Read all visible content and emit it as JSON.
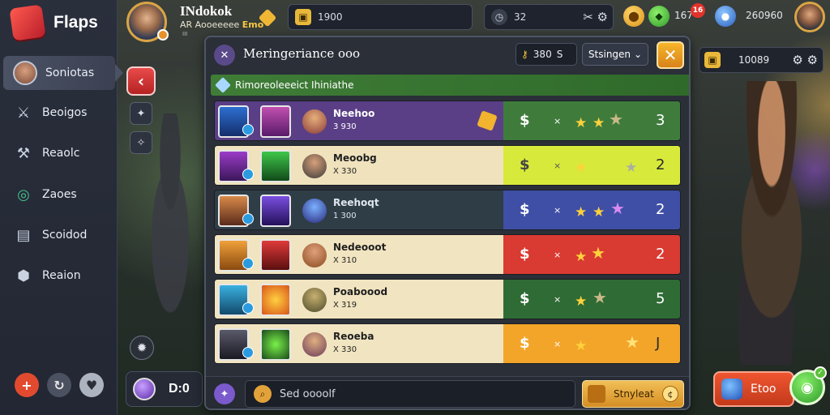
{
  "sidebar": {
    "logo_text": "Flaps",
    "items": [
      {
        "label": "Soniotas",
        "icon": "avatar",
        "active": true
      },
      {
        "label": "Beoigos",
        "icon": "sword-icon"
      },
      {
        "label": "Reaolc",
        "icon": "hammer-icon"
      },
      {
        "label": "Zaoes",
        "icon": "orb-icon"
      },
      {
        "label": "Scoidod",
        "icon": "scroll-icon"
      },
      {
        "label": "Reaion",
        "icon": "cube-icon"
      }
    ],
    "bottom_buttons": [
      {
        "name": "add",
        "glyph": "+"
      },
      {
        "name": "refresh",
        "glyph": "↻"
      },
      {
        "name": "heart",
        "glyph": "♥"
      }
    ]
  },
  "player": {
    "name": "INdokok",
    "sub_prefix": "AR Aooeeeee",
    "sub_gold": "Emo",
    "tag": "III"
  },
  "topbar": {
    "field_one": "1900",
    "field_two": "32",
    "coin_gold_label": "",
    "coin_green_label": "167",
    "notif_count": "16",
    "right_value": "260960"
  },
  "right_toolbar": {
    "value": "10089"
  },
  "panel": {
    "title": "Meringeriance ooo",
    "field_value": "380",
    "field_suffix": "S",
    "select_label": "Stsingen",
    "close_glyph": "✕",
    "subheader": "Rimoreoleeeict Ihiniathe",
    "rows": [
      {
        "name": "Neehoo",
        "sub": "3 930",
        "left_bg": "#5a3f86",
        "left_color": "#ffffff",
        "right_bg": "#3f7c3c",
        "stars": 3,
        "number": "3",
        "num_color": "#ffffff",
        "gem": true
      },
      {
        "name": "Meoobg",
        "sub": "X 330",
        "left_bg": "#efe2bd",
        "left_color": "#1f1f1f",
        "right_bg": "#d7ea3b",
        "stars": 1,
        "number": "2",
        "num_color": "#2a2a2a",
        "gem": false
      },
      {
        "name": "Reehoqt",
        "sub": "1 300",
        "left_bg": "#2f3d47",
        "left_color": "#dfe6ee",
        "right_bg": "#3f4fa6",
        "stars": 2,
        "number": "2",
        "num_color": "#ffffff",
        "gem": false
      },
      {
        "name": "Nedeooot",
        "sub": "X 310",
        "left_bg": "#f1e4c0",
        "left_color": "#1f1f1f",
        "right_bg": "#d93a32",
        "stars": 2,
        "number": "2",
        "num_color": "#ffffff",
        "gem": false
      },
      {
        "name": "Poaboood",
        "sub": "X 319",
        "left_bg": "#f1e4c0",
        "left_color": "#1f1f1f",
        "right_bg": "#2f6b35",
        "stars": 2,
        "number": "5",
        "num_color": "#ffffff",
        "gem": false
      },
      {
        "name": "Reoeba",
        "sub": "X 330",
        "left_bg": "#f1e4c0",
        "left_color": "#1f1f1f",
        "right_bg": "#f3a52a",
        "stars": 1,
        "number": "J",
        "num_color": "#2a2a2a",
        "gem": false
      }
    ],
    "search_placeholder": "Sed oooolf",
    "action_label": "Stnyleat"
  },
  "bottom": {
    "left_pill": "D:0",
    "action_label": "Etoo"
  }
}
